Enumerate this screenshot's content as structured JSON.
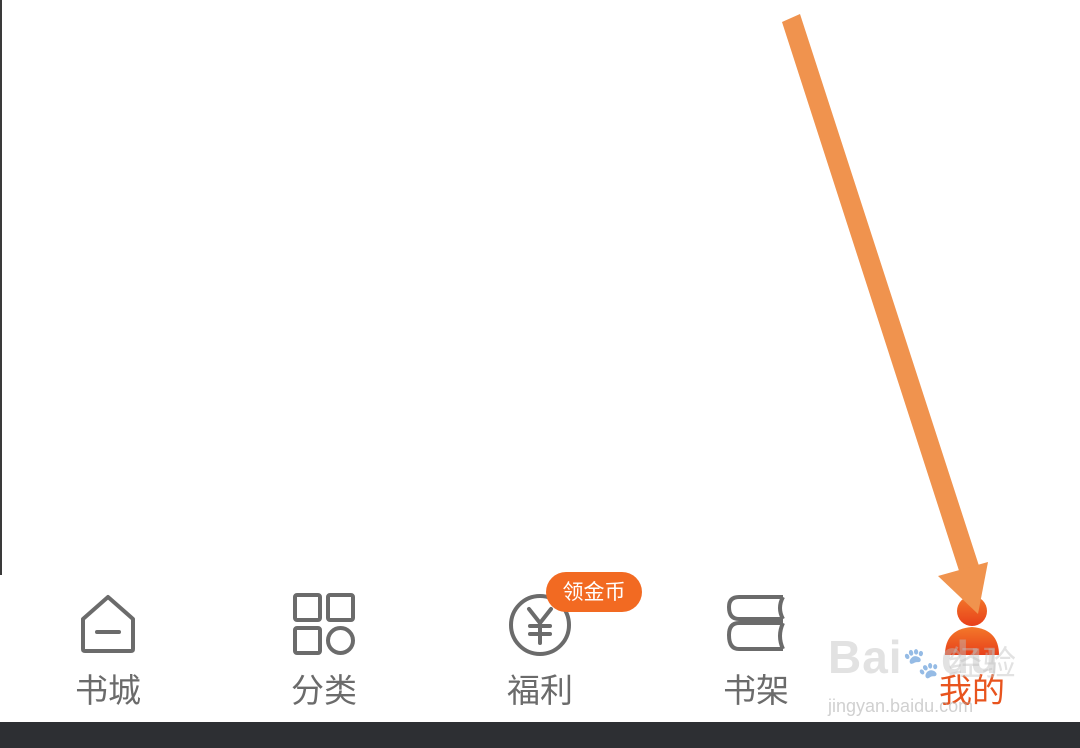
{
  "tabs": [
    {
      "label": "书城",
      "icon": "home-icon"
    },
    {
      "label": "分类",
      "icon": "category-grid-icon"
    },
    {
      "label": "福利",
      "icon": "yen-coin-icon"
    },
    {
      "label": "书架",
      "icon": "bookshelf-icon"
    },
    {
      "label": "我的",
      "icon": "profile-person-icon",
      "active": true
    }
  ],
  "badge": {
    "text": "领金币"
  },
  "watermark": {
    "brand": "Bai",
    "brand_tail": "du",
    "cn": "经验",
    "url": "jingyan.baidu.com"
  },
  "colors": {
    "accent": "#e8541e",
    "badge": "#f26a22",
    "arrow": "#f0934e",
    "icon_gray": "#6b6b6b",
    "bottom_bar": "#2d2f33"
  }
}
